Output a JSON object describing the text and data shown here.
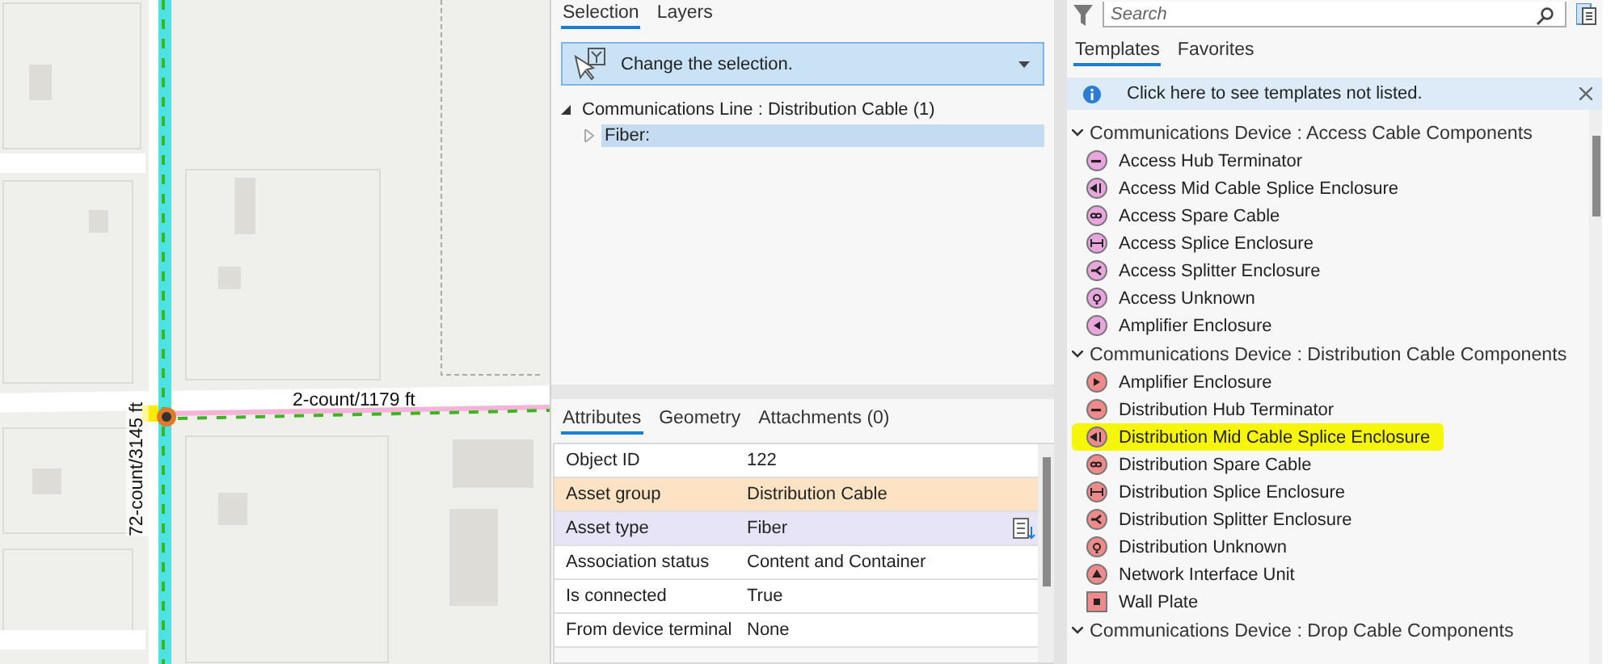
{
  "map": {
    "kind": "picture",
    "labels": [
      {
        "text": "2-count/1179 ft",
        "kind": "horizontal"
      },
      {
        "text": "72-count/3145 ft",
        "kind": "vertical"
      }
    ]
  },
  "selection_panel": {
    "tabs": [
      {
        "label": "Selection",
        "selected": true
      },
      {
        "label": "Layers",
        "selected": false
      }
    ],
    "dropdown": {
      "value": "Change the selection."
    },
    "tree": [
      {
        "label": "Communications Line : Distribution Cable (1)",
        "expanded": true,
        "selected": false,
        "children": [
          {
            "label": "Fiber:",
            "expanded": false,
            "selected": true
          }
        ]
      }
    ]
  },
  "attributes_panel": {
    "tabs": [
      {
        "label": "Attributes",
        "selected": true
      },
      {
        "label": "Geometry",
        "selected": false
      },
      {
        "label": "Attachments (0)",
        "selected": false
      }
    ],
    "rows": [
      {
        "field": "Object ID",
        "value": "122",
        "color": "#ffffff",
        "picker": false
      },
      {
        "field": "Asset group",
        "value": "Distribution Cable",
        "color": "#fde3c3",
        "picker": false
      },
      {
        "field": "Asset type",
        "value": "Fiber",
        "color": "#e8e4f8",
        "picker": true
      },
      {
        "field": "Association status",
        "value": "Content and Container",
        "color": "#ffffff",
        "picker": false
      },
      {
        "field": "Is connected",
        "value": "True",
        "color": "#ffffff",
        "picker": false
      },
      {
        "field": "From device terminal",
        "value": "None",
        "color": "#ffffff",
        "picker": false
      }
    ]
  },
  "templates_panel": {
    "search": {
      "placeholder": "Search"
    },
    "tabs": [
      {
        "label": "Templates",
        "selected": true
      },
      {
        "label": "Favorites",
        "selected": false
      }
    ],
    "info": "Click here to see templates not listed.",
    "groups": [
      {
        "title": "Communications Device : Access Cable Components",
        "expanded": true,
        "items": [
          {
            "label": "Access Hub Terminator",
            "kind": "terminator",
            "color": "#e9a6de",
            "highlighted": false
          },
          {
            "label": "Access Mid Cable Splice Enclosure",
            "kind": "mid-splice",
            "color": "#e9a6de",
            "highlighted": false
          },
          {
            "label": "Access Spare Cable",
            "kind": "spare",
            "color": "#e9a6de",
            "highlighted": false
          },
          {
            "label": "Access Splice Enclosure",
            "kind": "splice",
            "color": "#e9a6de",
            "highlighted": false
          },
          {
            "label": "Access Splitter Enclosure",
            "kind": "splitter",
            "color": "#e9a6de",
            "highlighted": false
          },
          {
            "label": "Access Unknown",
            "kind": "unknown",
            "color": "#e9a6de",
            "highlighted": false
          },
          {
            "label": "Amplifier Enclosure",
            "kind": "amplifier-left",
            "color": "#e9a6de",
            "highlighted": false
          }
        ]
      },
      {
        "title": "Communications Device : Distribution Cable Components",
        "expanded": true,
        "items": [
          {
            "label": "Amplifier Enclosure",
            "kind": "amplifier-right",
            "color": "#f08a8a",
            "highlighted": false
          },
          {
            "label": "Distribution Hub Terminator",
            "kind": "terminator",
            "color": "#f08a8a",
            "highlighted": false
          },
          {
            "label": "Distribution Mid Cable Splice Enclosure",
            "kind": "mid-splice",
            "color": "#f08a8a",
            "highlighted": true
          },
          {
            "label": "Distribution Spare Cable",
            "kind": "spare",
            "color": "#f08a8a",
            "highlighted": false
          },
          {
            "label": "Distribution Splice Enclosure",
            "kind": "splice",
            "color": "#f08a8a",
            "highlighted": false
          },
          {
            "label": "Distribution Splitter Enclosure",
            "kind": "splitter",
            "color": "#f08a8a",
            "highlighted": false
          },
          {
            "label": "Distribution Unknown",
            "kind": "unknown",
            "color": "#f08a8a",
            "highlighted": false
          },
          {
            "label": "Network Interface Unit",
            "kind": "nid",
            "color": "#f08a8a",
            "highlighted": false
          },
          {
            "label": "Wall Plate",
            "kind": "wall-plate",
            "color": "#f08a8a",
            "highlighted": false
          }
        ]
      },
      {
        "title": "Communications Device : Drop Cable Components",
        "expanded": true
      }
    ]
  }
}
